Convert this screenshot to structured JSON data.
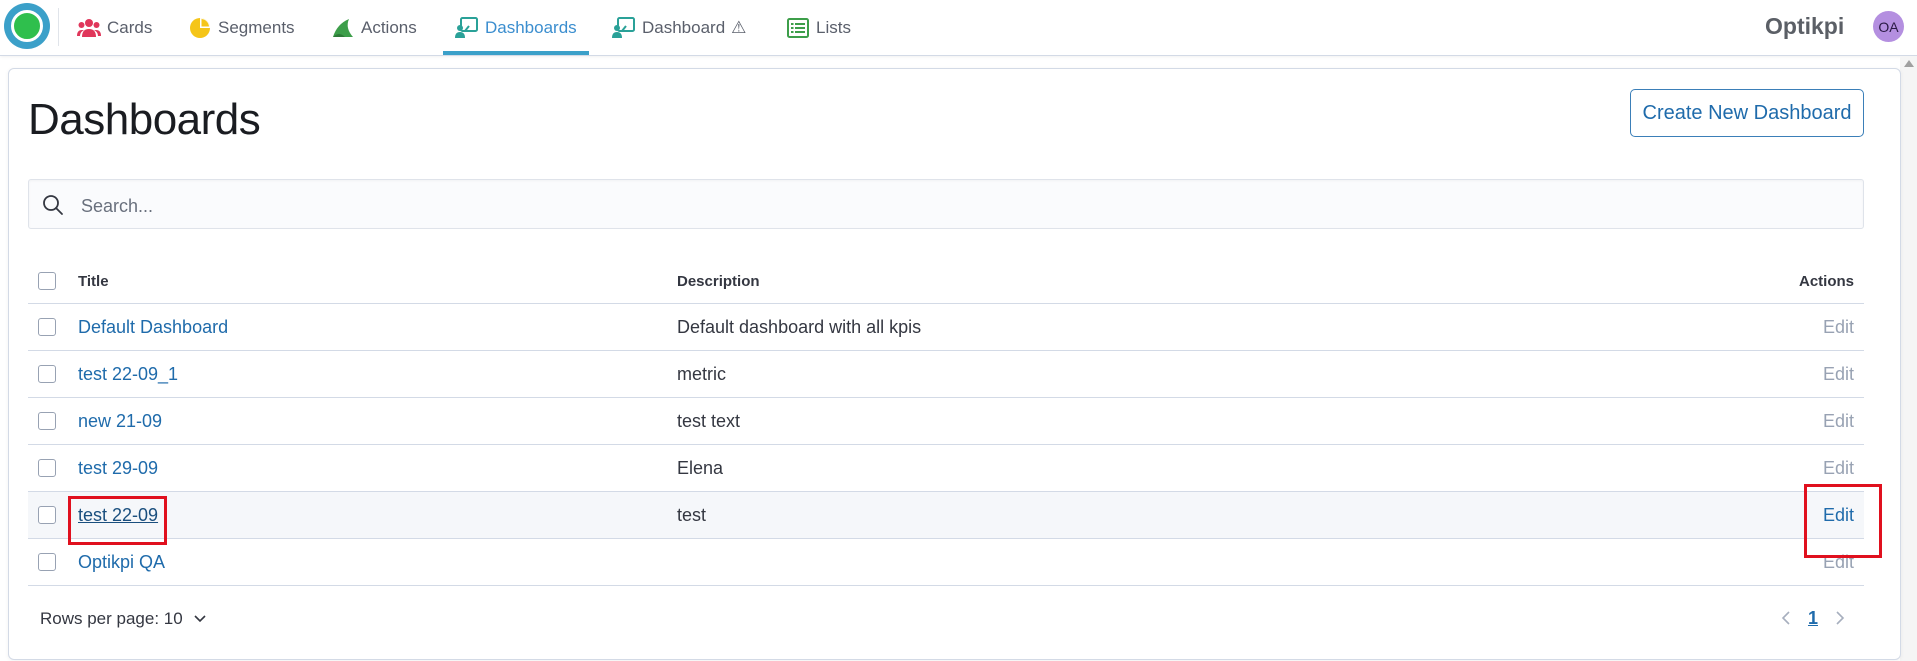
{
  "nav": {
    "tabs": [
      {
        "label": "Cards",
        "icon": "users-icon"
      },
      {
        "label": "Segments",
        "icon": "pie-chart-icon"
      },
      {
        "label": "Actions",
        "icon": "actions-icon"
      },
      {
        "label": "Dashboards",
        "icon": "dashboard-icon",
        "active": true
      },
      {
        "label": "Dashboard",
        "icon": "dashboard-icon",
        "suffix": "⚠"
      },
      {
        "label": "Lists",
        "icon": "list-icon"
      }
    ],
    "brand": "Optikpi",
    "avatar_initials": "OA"
  },
  "page": {
    "title": "Dashboards",
    "create_button": "Create New Dashboard",
    "search_placeholder": "Search..."
  },
  "table": {
    "headers": {
      "title": "Title",
      "description": "Description",
      "actions": "Actions"
    },
    "rows": [
      {
        "title": "Default Dashboard",
        "description": "Default dashboard with all kpis",
        "action": "Edit"
      },
      {
        "title": "test 22-09_1",
        "description": "metric",
        "action": "Edit"
      },
      {
        "title": "new 21-09",
        "description": "test text",
        "action": "Edit"
      },
      {
        "title": "test 29-09",
        "description": "Elena",
        "action": "Edit"
      },
      {
        "title": "test 22-09",
        "description": "test",
        "action": "Edit"
      },
      {
        "title": "Optikpi QA",
        "description": "",
        "action": "Edit"
      }
    ]
  },
  "footer": {
    "rows_per_page": "Rows per page: 10",
    "current_page": "1"
  },
  "colors": {
    "accent": "#3ba0c9",
    "link": "#1f6bab",
    "highlight": "#e0101e"
  }
}
